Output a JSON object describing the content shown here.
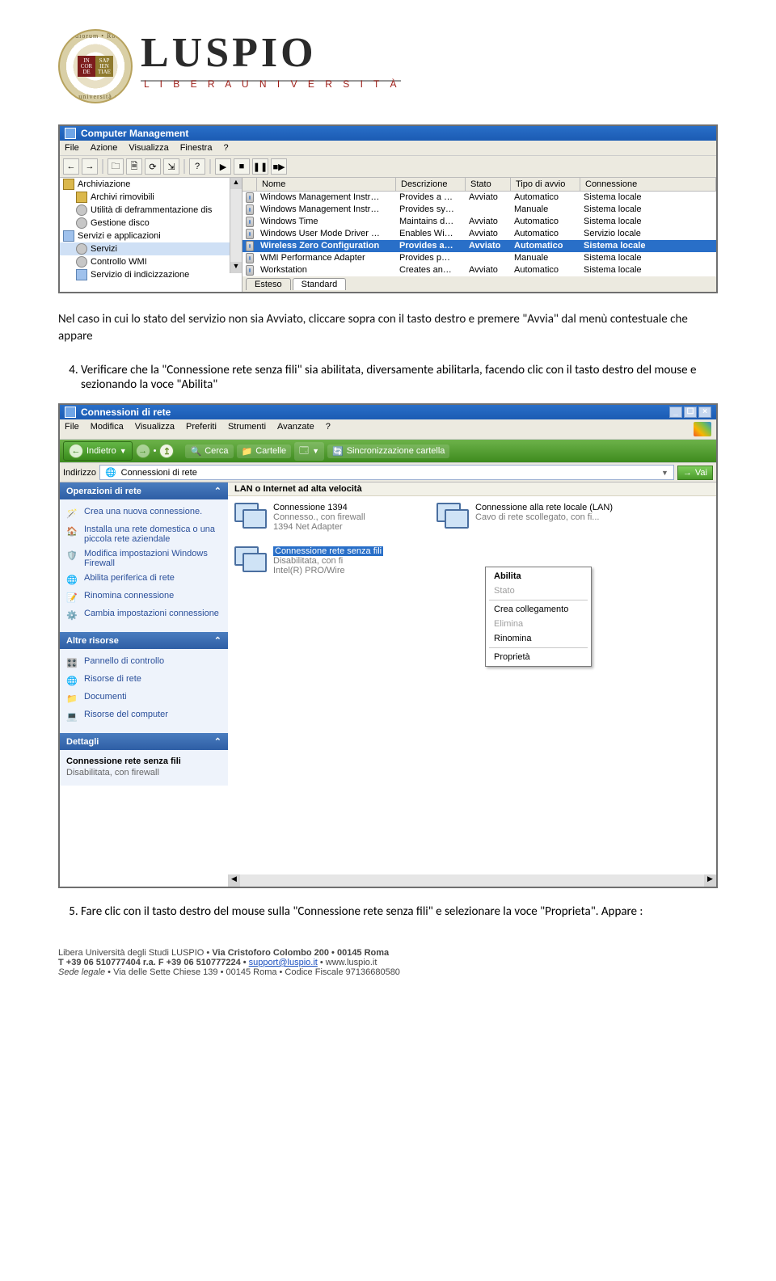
{
  "logo": {
    "seal_left": "IN COR DE",
    "seal_right": "SAP IEN TIAE",
    "seal_top": "studiorum • Roma",
    "seal_bot": "• università •",
    "title": "LUSPIO",
    "subtitle": "L I B E R A   U N I V E R S I T À"
  },
  "cm": {
    "title": "Computer Management",
    "menus": [
      "File",
      "Azione",
      "Visualizza",
      "Finestra",
      "?"
    ],
    "tree": [
      {
        "lvl": 0,
        "label": "Archiviazione",
        "ico": "folder"
      },
      {
        "lvl": 1,
        "label": "Archivi rimovibili",
        "ico": "folder"
      },
      {
        "lvl": 1,
        "label": "Utilità di deframmentazione dis",
        "ico": "gear"
      },
      {
        "lvl": 1,
        "label": "Gestione disco",
        "ico": "gear"
      },
      {
        "lvl": 0,
        "label": "Servizi e applicazioni",
        "ico": "srv"
      },
      {
        "lvl": 1,
        "label": "Servizi",
        "ico": "gear",
        "sel": true
      },
      {
        "lvl": 1,
        "label": "Controllo WMI",
        "ico": "gear"
      },
      {
        "lvl": 1,
        "label": "Servizio di indicizzazione",
        "ico": "srv"
      }
    ],
    "cols": {
      "nome": "Nome",
      "desc": "Descrizione",
      "stato": "Stato",
      "tipo": "Tipo di avvio",
      "conn": "Connessione"
    },
    "rows": [
      {
        "n": "Windows Management Instr…",
        "d": "Provides a …",
        "s": "Avviato",
        "t": "Automatico",
        "c": "Sistema locale"
      },
      {
        "n": "Windows Management Instr…",
        "d": "Provides sy…",
        "s": "",
        "t": "Manuale",
        "c": "Sistema locale"
      },
      {
        "n": "Windows Time",
        "d": "Maintains d…",
        "s": "Avviato",
        "t": "Automatico",
        "c": "Sistema locale"
      },
      {
        "n": "Windows User Mode Driver …",
        "d": "Enables Wi…",
        "s": "Avviato",
        "t": "Automatico",
        "c": "Servizio locale"
      },
      {
        "n": "Wireless Zero Configuration",
        "d": "Provides a…",
        "s": "Avviato",
        "t": "Automatico",
        "c": "Sistema locale",
        "sel": true
      },
      {
        "n": "WMI Performance Adapter",
        "d": "Provides p…",
        "s": "",
        "t": "Manuale",
        "c": "Sistema locale"
      },
      {
        "n": "Workstation",
        "d": "Creates an…",
        "s": "Avviato",
        "t": "Automatico",
        "c": "Sistema locale"
      }
    ],
    "tabs": {
      "esteso": "Esteso",
      "standard": "Standard"
    }
  },
  "para1": "Nel caso in cui lo stato del servizio non sia Avviato, cliccare sopra con il tasto destro e premere \"Avvia\" dal menù contestuale che appare",
  "step4_num": "4.",
  "step4": "Verificare che la \"Connessione rete senza fili\" sia abilitata, diversamente abilitarla, facendo clic con il tasto destro del mouse e sezionando la voce \"Abilita\"",
  "nc": {
    "title": "Connessioni di rete",
    "menus": [
      "File",
      "Modifica",
      "Visualizza",
      "Preferiti",
      "Strumenti",
      "Avanzate",
      "?"
    ],
    "back": "Indietro",
    "search": "Cerca",
    "folders": "Cartelle",
    "sync": "Sincronizzazione cartella",
    "addr_label": "Indirizzo",
    "addr_value": "Connessioni di rete",
    "go": "Vai",
    "panels": {
      "ops": "Operazioni di rete",
      "ops_items": [
        {
          "ico": "🪄",
          "txt": "Crea una nuova connessione."
        },
        {
          "ico": "🏠",
          "txt": "Installa una rete domestica o una piccola rete aziendale"
        },
        {
          "ico": "🛡️",
          "txt": "Modifica impostazioni Windows Firewall"
        },
        {
          "ico": "🌐",
          "txt": "Abilita periferica di rete"
        },
        {
          "ico": "📝",
          "txt": "Rinomina connessione"
        },
        {
          "ico": "⚙️",
          "txt": "Cambia impostazioni connessione"
        }
      ],
      "other": "Altre risorse",
      "other_items": [
        {
          "ico": "🎛️",
          "txt": "Pannello di controllo"
        },
        {
          "ico": "🌐",
          "txt": "Risorse di rete"
        },
        {
          "ico": "📁",
          "txt": "Documenti"
        },
        {
          "ico": "💻",
          "txt": "Risorse del computer"
        }
      ],
      "details": "Dettagli",
      "det_title": "Connessione rete senza fili",
      "det_sub": "Disabilitata, con firewall"
    },
    "group": "LAN o Internet ad alta velocità",
    "conns": [
      {
        "t1": "Connessione 1394",
        "t2": "Connesso., con firewall",
        "t3": "1394 Net Adapter"
      },
      {
        "t1": "Connessione alla rete locale (LAN)",
        "t2": "Cavo di rete scollegato, con fi...",
        "t3": ""
      },
      {
        "t1": "Connessione rete senza fili",
        "t2": "Disabilitata, con fi",
        "t3": "Intel(R) PRO/Wire",
        "sel": true
      }
    ],
    "ctx": [
      "Abilita",
      "Stato",
      "Crea collegamento",
      "Elimina",
      "Rinomina",
      "Proprietà"
    ]
  },
  "step5_num": "5.",
  "step5": "Fare clic con il tasto destro del mouse sulla \"Connessione rete senza fili\" e selezionare la voce \"Proprieta\". Appare :",
  "footer": {
    "l1a": "Libera Università degli Studi LUSPIO • ",
    "l1b": "Via Cristoforo Colombo 200 • 00145 Roma",
    "l2a": "T +39 06 510777404 r.a. F +39 06 510777224 • ",
    "l2link": "support@luspio.it",
    "l2b": " • www.luspio.it",
    "l3i": "Sede legale ",
    "l3": "• Via delle Sette Chiese 139 • 00145 Roma • Codice Fiscale 97136680580"
  }
}
